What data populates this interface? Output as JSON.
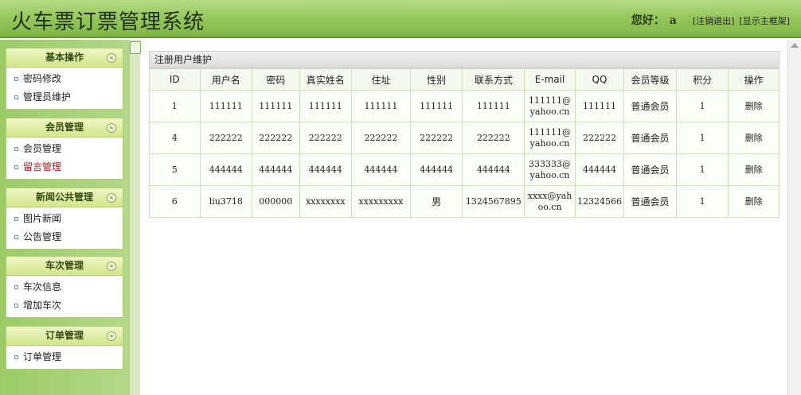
{
  "header": {
    "title": "火车票订票管理系统",
    "greeting": "您好：",
    "username": "a",
    "logout_link": "[注销退出]",
    "show_frame_link": "[显示主框架]"
  },
  "sidebar": {
    "groups": [
      {
        "title": "基本操作",
        "items": [
          "密码修改",
          "管理员维护"
        ]
      },
      {
        "title": "会员管理",
        "items": [
          "会员管理",
          "留言管理"
        ]
      },
      {
        "title": "新闻公共管理",
        "items": [
          "图片新闻",
          "公告管理"
        ]
      },
      {
        "title": "车次管理",
        "items": [
          "车次信息",
          "增加车次"
        ]
      },
      {
        "title": "订单管理",
        "items": [
          "订单管理"
        ]
      }
    ],
    "collapse_glyph": "«"
  },
  "main": {
    "panel_title": "注册用户维护",
    "columns": [
      "ID",
      "用户名",
      "密码",
      "真实姓名",
      "住址",
      "性别",
      "联系方式",
      "E-mail",
      "QQ",
      "会员等级",
      "积分",
      "操作"
    ],
    "rows": [
      [
        "1",
        "111111",
        "111111",
        "111111",
        "111111",
        "111111",
        "111111",
        "111111@yahoo.cn",
        "111111",
        "普通会员",
        "1",
        "删除"
      ],
      [
        "4",
        "222222",
        "222222",
        "222222",
        "222222",
        "222222",
        "222222",
        "111111@yahoo.cn",
        "222222",
        "普通会员",
        "1",
        "删除"
      ],
      [
        "5",
        "444444",
        "444444",
        "444444",
        "444444",
        "444444",
        "444444",
        "333333@yahoo.cn",
        "444444",
        "普通会员",
        "1",
        "删除"
      ],
      [
        "6",
        "liu3718",
        "000000",
        "xxxxxxxx",
        "xxxxxxxxx",
        "男",
        "1324567895",
        "xxxx@yahoo.cn",
        "12324566",
        "普通会员",
        "1",
        "删除"
      ]
    ]
  }
}
